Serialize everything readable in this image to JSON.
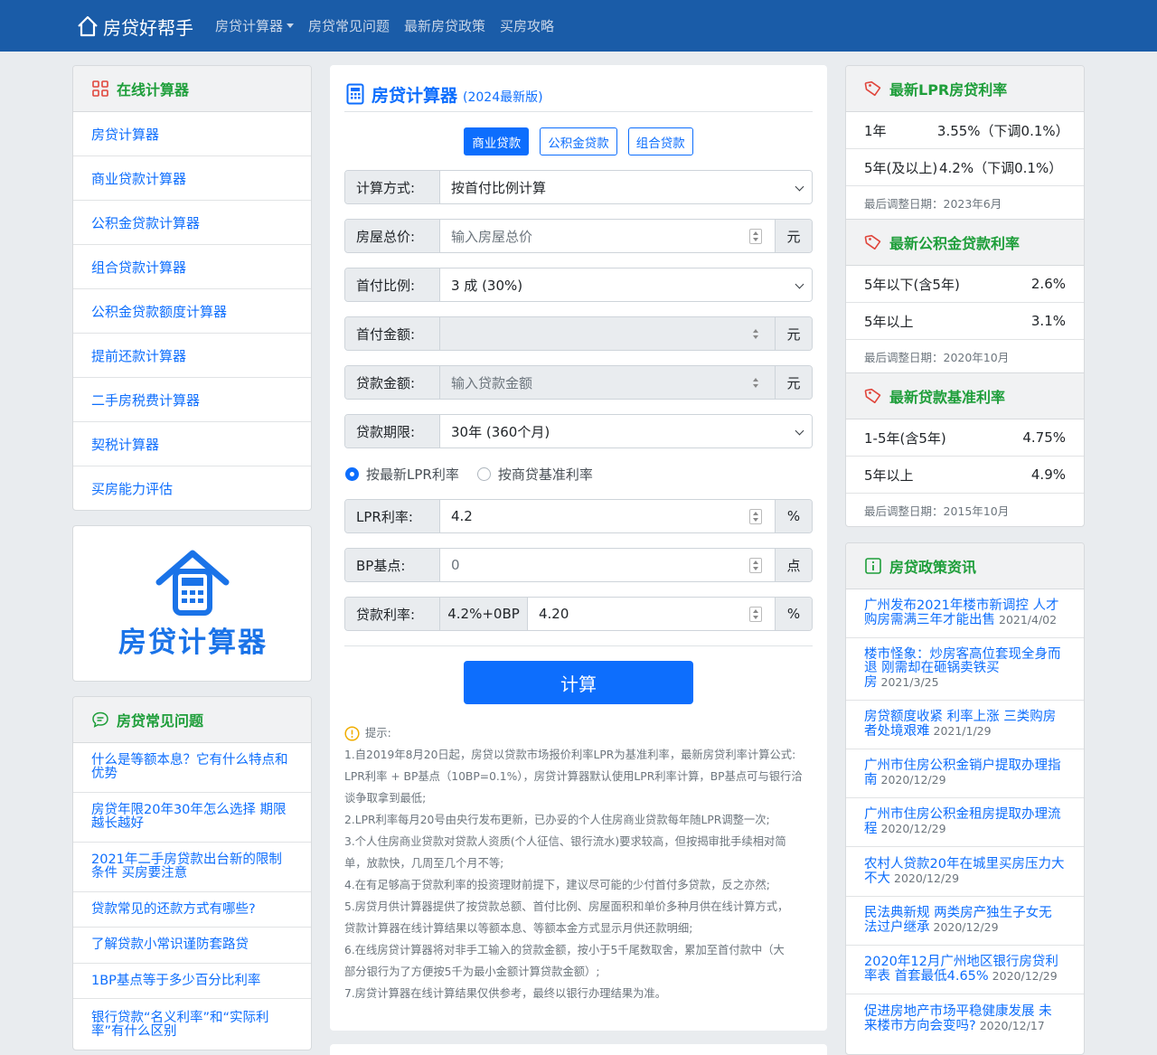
{
  "nav": {
    "brand": "房贷好帮手",
    "links": [
      "房贷计算器",
      "房贷常见问题",
      "最新房贷政策",
      "买房攻略"
    ]
  },
  "left": {
    "calc_title": "在线计算器",
    "calc_items": [
      "房贷计算器",
      "商业贷款计算器",
      "公积金贷款计算器",
      "组合贷款计算器",
      "公积金贷款额度计算器",
      "提前还款计算器",
      "二手房税费计算器",
      "契税计算器",
      "买房能力评估"
    ],
    "logo_text": "房贷计算器",
    "faq_title": "房贷常见问题",
    "faq_items": [
      "什么是等额本息？它有什么特点和优势",
      "房贷年限20年30年怎么选择 期限越长越好",
      "2021年二手房贷款出台新的限制条件 买房要注意",
      "贷款常见的还款方式有哪些?",
      "了解贷款小常识谨防套路贷",
      "1BP基点等于多少百分比利率",
      "银行贷款“名义利率”和“实际利率”有什么区别"
    ]
  },
  "main": {
    "title": "房贷计算器",
    "subtitle": "(2024最新版)",
    "tabs": [
      "商业贷款",
      "公积金贷款",
      "组合贷款"
    ],
    "fields": {
      "method": {
        "label": "计算方式:",
        "value": "按首付比例计算"
      },
      "price": {
        "label": "房屋总价:",
        "placeholder": "输入房屋总价",
        "unit": "元"
      },
      "ratio": {
        "label": "首付比例:",
        "value": "3 成 (30%)"
      },
      "down": {
        "label": "首付金额:",
        "value": "",
        "unit": "元"
      },
      "loan": {
        "label": "贷款金额:",
        "placeholder": "输入贷款金额",
        "unit": "元"
      },
      "term": {
        "label": "贷款期限:",
        "value": "30年 (360个月)"
      },
      "lpr": {
        "label": "LPR利率:",
        "value": "4.2",
        "unit": "%"
      },
      "bp": {
        "label": "BP基点:",
        "value": "0",
        "unit": "点"
      },
      "rate": {
        "label": "贷款利率:",
        "formula": "4.2%+0BP",
        "value": "4.20",
        "unit": "%"
      }
    },
    "radio_lpr": "按最新LPR利率",
    "radio_base": "按商贷基准利率",
    "calc_button": "计算",
    "tips_title": "提示:",
    "tips": [
      "1.自2019年8月20日起，房贷以贷款市场报价利率LPR为基准利率，最新房贷利率计算公式:",
      "LPR利率 + BP基点（10BP=0.1%），房贷计算器默认使用LPR利率计算，BP基点可与银行洽",
      "谈争取拿到最低;",
      "2.LPR利率每月20号由央行发布更新，已办妥的个人住房商业贷款每年随LPR调整一次;",
      "3.个人住房商业贷款对贷款人资质(个人征信、银行流水)要求较高，但按揭审批手续相对简",
      "单，放款快，几周至几个月不等;",
      "4.在有足够高于贷款利率的投资理财前提下，建议尽可能的少付首付多贷款，反之亦然;",
      "5.房贷月供计算器提供了按贷款总额、首付比例、房屋面积和单价多种月供在线计算方式，",
      "贷款计算器在线计算结果以等额本息、等额本金方式显示月供还款明细;",
      "6.在线房贷计算器将对非手工输入的贷款金额，按小于5千尾数取舍，累加至首付款中（大",
      "部分银行为了方便按5千为最小金额计算贷款金额）;",
      "7.房贷计算器在线计算结果仅供参考，最终以银行办理结果为准。"
    ]
  },
  "right": {
    "lpr": {
      "title": "最新LPR房贷利率",
      "rows": [
        {
          "k": "1年",
          "v": "3.55%（下调0.1%）"
        },
        {
          "k": "5年(及以上)",
          "v": "4.2%（下调0.1%）"
        }
      ],
      "date": "最后调整日期：2023年6月"
    },
    "fund": {
      "title": "最新公积金贷款利率",
      "rows": [
        {
          "k": "5年以下(含5年)",
          "v": "2.6%"
        },
        {
          "k": "5年以上",
          "v": "3.1%"
        }
      ],
      "date": "最后调整日期：2020年10月"
    },
    "base": {
      "title": "最新贷款基准利率",
      "rows": [
        {
          "k": "1-5年(含5年)",
          "v": "4.75%"
        },
        {
          "k": "5年以上",
          "v": "4.9%"
        }
      ],
      "date": "最后调整日期：2015年10月"
    },
    "news_title": "房贷政策资讯",
    "news": [
      {
        "l1": "广州发布2021年楼市新调控 人才",
        "l2": "购房需满三年才能出售",
        "d": "2021/4/02"
      },
      {
        "l1": "楼市怪象：炒房客高位套现全身而",
        "l2": "退 刚需却在砸锅卖铁买",
        "l3": "房",
        "d": "2021/3/25"
      },
      {
        "l1": "房贷额度收紧 利率上涨 三类购房",
        "l2": "者处境艰难",
        "d": "2021/1/29"
      },
      {
        "l1": "广州市住房公积金销户提取办理指",
        "l2": "南",
        "d": "2020/12/29"
      },
      {
        "l1": "广州市住房公积金租房提取办理流",
        "l2": "程",
        "d": "2020/12/29"
      },
      {
        "l1": "农村人贷款20年在城里买房压力大",
        "l2": "不大",
        "d": "2020/12/29"
      },
      {
        "l1": "民法典新规 两类房产独生子女无",
        "l2": "法过户继承",
        "d": "2020/12/29"
      },
      {
        "l1": "2020年12月广州地区银行房贷利",
        "l2": "率表 首套最低4.65%",
        "d": "2020/12/29"
      },
      {
        "l1": "促进房地产市场平稳健康发展 未",
        "l2": "来楼市方向会变吗?",
        "d": "2020/12/17"
      }
    ]
  }
}
